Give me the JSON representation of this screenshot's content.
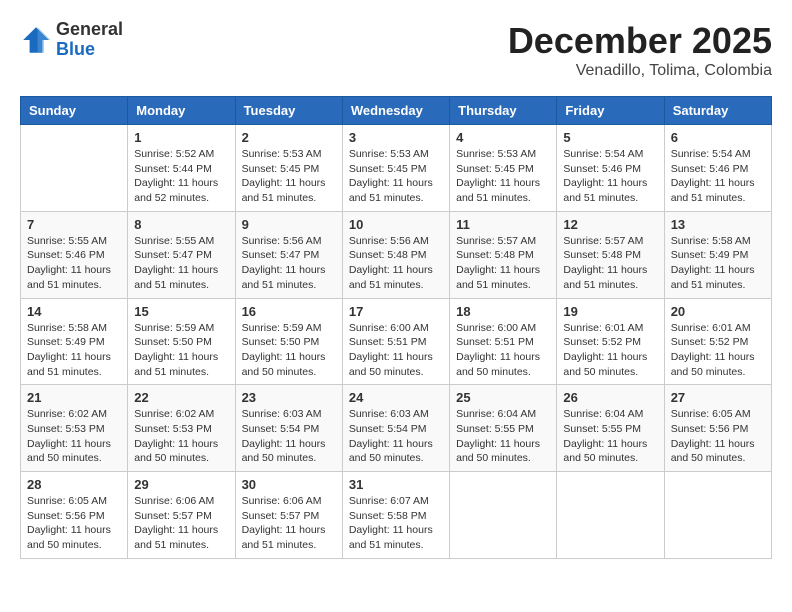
{
  "logo": {
    "general": "General",
    "blue": "Blue"
  },
  "header": {
    "month": "December 2025",
    "location": "Venadillo, Tolima, Colombia"
  },
  "days_of_week": [
    "Sunday",
    "Monday",
    "Tuesday",
    "Wednesday",
    "Thursday",
    "Friday",
    "Saturday"
  ],
  "weeks": [
    [
      {
        "day": "",
        "info": ""
      },
      {
        "day": "1",
        "sunrise": "Sunrise: 5:52 AM",
        "sunset": "Sunset: 5:44 PM",
        "daylight": "Daylight: 11 hours and 52 minutes."
      },
      {
        "day": "2",
        "sunrise": "Sunrise: 5:53 AM",
        "sunset": "Sunset: 5:45 PM",
        "daylight": "Daylight: 11 hours and 51 minutes."
      },
      {
        "day": "3",
        "sunrise": "Sunrise: 5:53 AM",
        "sunset": "Sunset: 5:45 PM",
        "daylight": "Daylight: 11 hours and 51 minutes."
      },
      {
        "day": "4",
        "sunrise": "Sunrise: 5:53 AM",
        "sunset": "Sunset: 5:45 PM",
        "daylight": "Daylight: 11 hours and 51 minutes."
      },
      {
        "day": "5",
        "sunrise": "Sunrise: 5:54 AM",
        "sunset": "Sunset: 5:46 PM",
        "daylight": "Daylight: 11 hours and 51 minutes."
      },
      {
        "day": "6",
        "sunrise": "Sunrise: 5:54 AM",
        "sunset": "Sunset: 5:46 PM",
        "daylight": "Daylight: 11 hours and 51 minutes."
      }
    ],
    [
      {
        "day": "7",
        "sunrise": "Sunrise: 5:55 AM",
        "sunset": "Sunset: 5:46 PM",
        "daylight": "Daylight: 11 hours and 51 minutes."
      },
      {
        "day": "8",
        "sunrise": "Sunrise: 5:55 AM",
        "sunset": "Sunset: 5:47 PM",
        "daylight": "Daylight: 11 hours and 51 minutes."
      },
      {
        "day": "9",
        "sunrise": "Sunrise: 5:56 AM",
        "sunset": "Sunset: 5:47 PM",
        "daylight": "Daylight: 11 hours and 51 minutes."
      },
      {
        "day": "10",
        "sunrise": "Sunrise: 5:56 AM",
        "sunset": "Sunset: 5:48 PM",
        "daylight": "Daylight: 11 hours and 51 minutes."
      },
      {
        "day": "11",
        "sunrise": "Sunrise: 5:57 AM",
        "sunset": "Sunset: 5:48 PM",
        "daylight": "Daylight: 11 hours and 51 minutes."
      },
      {
        "day": "12",
        "sunrise": "Sunrise: 5:57 AM",
        "sunset": "Sunset: 5:48 PM",
        "daylight": "Daylight: 11 hours and 51 minutes."
      },
      {
        "day": "13",
        "sunrise": "Sunrise: 5:58 AM",
        "sunset": "Sunset: 5:49 PM",
        "daylight": "Daylight: 11 hours and 51 minutes."
      }
    ],
    [
      {
        "day": "14",
        "sunrise": "Sunrise: 5:58 AM",
        "sunset": "Sunset: 5:49 PM",
        "daylight": "Daylight: 11 hours and 51 minutes."
      },
      {
        "day": "15",
        "sunrise": "Sunrise: 5:59 AM",
        "sunset": "Sunset: 5:50 PM",
        "daylight": "Daylight: 11 hours and 51 minutes."
      },
      {
        "day": "16",
        "sunrise": "Sunrise: 5:59 AM",
        "sunset": "Sunset: 5:50 PM",
        "daylight": "Daylight: 11 hours and 50 minutes."
      },
      {
        "day": "17",
        "sunrise": "Sunrise: 6:00 AM",
        "sunset": "Sunset: 5:51 PM",
        "daylight": "Daylight: 11 hours and 50 minutes."
      },
      {
        "day": "18",
        "sunrise": "Sunrise: 6:00 AM",
        "sunset": "Sunset: 5:51 PM",
        "daylight": "Daylight: 11 hours and 50 minutes."
      },
      {
        "day": "19",
        "sunrise": "Sunrise: 6:01 AM",
        "sunset": "Sunset: 5:52 PM",
        "daylight": "Daylight: 11 hours and 50 minutes."
      },
      {
        "day": "20",
        "sunrise": "Sunrise: 6:01 AM",
        "sunset": "Sunset: 5:52 PM",
        "daylight": "Daylight: 11 hours and 50 minutes."
      }
    ],
    [
      {
        "day": "21",
        "sunrise": "Sunrise: 6:02 AM",
        "sunset": "Sunset: 5:53 PM",
        "daylight": "Daylight: 11 hours and 50 minutes."
      },
      {
        "day": "22",
        "sunrise": "Sunrise: 6:02 AM",
        "sunset": "Sunset: 5:53 PM",
        "daylight": "Daylight: 11 hours and 50 minutes."
      },
      {
        "day": "23",
        "sunrise": "Sunrise: 6:03 AM",
        "sunset": "Sunset: 5:54 PM",
        "daylight": "Daylight: 11 hours and 50 minutes."
      },
      {
        "day": "24",
        "sunrise": "Sunrise: 6:03 AM",
        "sunset": "Sunset: 5:54 PM",
        "daylight": "Daylight: 11 hours and 50 minutes."
      },
      {
        "day": "25",
        "sunrise": "Sunrise: 6:04 AM",
        "sunset": "Sunset: 5:55 PM",
        "daylight": "Daylight: 11 hours and 50 minutes."
      },
      {
        "day": "26",
        "sunrise": "Sunrise: 6:04 AM",
        "sunset": "Sunset: 5:55 PM",
        "daylight": "Daylight: 11 hours and 50 minutes."
      },
      {
        "day": "27",
        "sunrise": "Sunrise: 6:05 AM",
        "sunset": "Sunset: 5:56 PM",
        "daylight": "Daylight: 11 hours and 50 minutes."
      }
    ],
    [
      {
        "day": "28",
        "sunrise": "Sunrise: 6:05 AM",
        "sunset": "Sunset: 5:56 PM",
        "daylight": "Daylight: 11 hours and 50 minutes."
      },
      {
        "day": "29",
        "sunrise": "Sunrise: 6:06 AM",
        "sunset": "Sunset: 5:57 PM",
        "daylight": "Daylight: 11 hours and 51 minutes."
      },
      {
        "day": "30",
        "sunrise": "Sunrise: 6:06 AM",
        "sunset": "Sunset: 5:57 PM",
        "daylight": "Daylight: 11 hours and 51 minutes."
      },
      {
        "day": "31",
        "sunrise": "Sunrise: 6:07 AM",
        "sunset": "Sunset: 5:58 PM",
        "daylight": "Daylight: 11 hours and 51 minutes."
      },
      {
        "day": "",
        "info": ""
      },
      {
        "day": "",
        "info": ""
      },
      {
        "day": "",
        "info": ""
      }
    ]
  ]
}
